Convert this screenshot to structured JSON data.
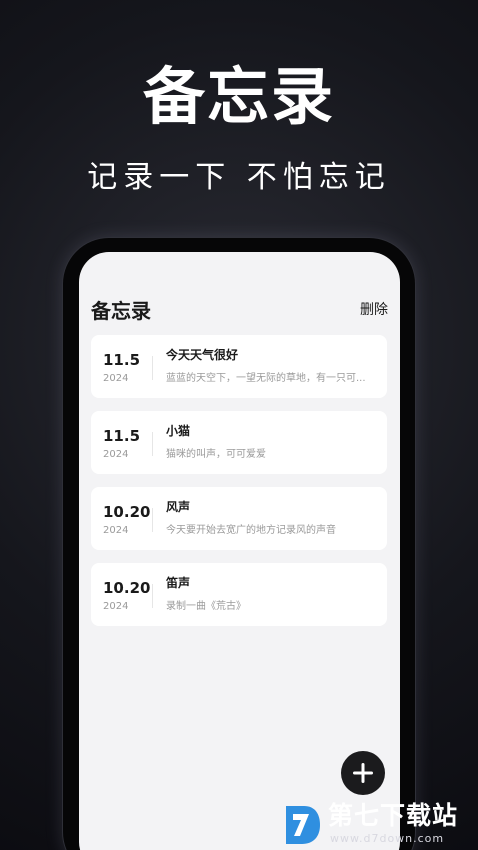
{
  "promo": {
    "title": "备忘录",
    "subtitle": "记录一下 不怕忘记"
  },
  "app": {
    "title": "备忘录",
    "delete_label": "删除"
  },
  "memos": [
    {
      "day": "11.5",
      "year": "2024",
      "title": "今天天气很好",
      "preview": "蓝蓝的天空下，一望无际的草地，有一只可..."
    },
    {
      "day": "11.5",
      "year": "2024",
      "title": "小猫",
      "preview": "猫咪的叫声，可可爱爱"
    },
    {
      "day": "10.20",
      "year": "2024",
      "title": "风声",
      "preview": "今天要开始去宽广的地方记录风的声音"
    },
    {
      "day": "10.20",
      "year": "2024",
      "title": "笛声",
      "preview": "录制一曲《荒古》"
    }
  ],
  "fab": {
    "icon": "plus-icon"
  },
  "watermark": {
    "name": "第七下载站",
    "url": "www.d7down.com"
  },
  "colors": {
    "background": "#15161c",
    "screen": "#f3f3f5",
    "card": "#ffffff",
    "fab": "#1b1b1d",
    "watermark_blue": "#2f8fe0"
  }
}
